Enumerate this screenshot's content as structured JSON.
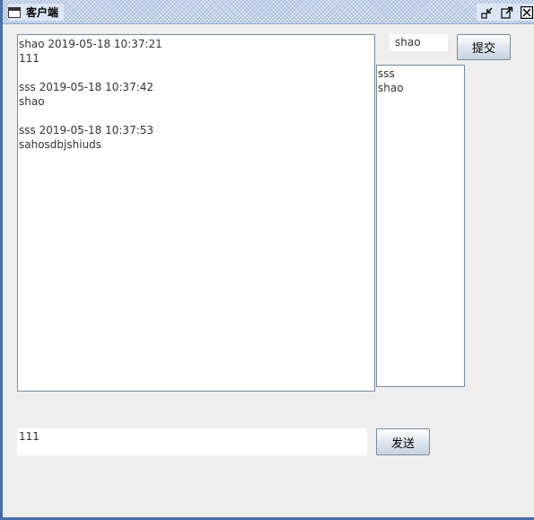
{
  "window": {
    "title": "客户端",
    "icons": [
      "window-icon",
      "minimize-icon",
      "maximize-icon",
      "close-icon"
    ]
  },
  "chat": {
    "messages": [
      {
        "header": "shao 2019-05-18 10:37:21",
        "body": "111"
      },
      {
        "header": "sss 2019-05-18 10:37:42",
        "body": "shao"
      },
      {
        "header": "sss 2019-05-18 10:37:53",
        "body": "sahosdbjshiuds"
      }
    ]
  },
  "name_field": {
    "value": "shao"
  },
  "submit_button": {
    "label": "提交"
  },
  "users": [
    "sss",
    "shao"
  ],
  "message_field": {
    "value": "111"
  },
  "send_button": {
    "label": "发送"
  },
  "colors": {
    "background": "#eeeeee",
    "frame_border": "#4a6ea9",
    "field_border": "#7a8a99"
  }
}
